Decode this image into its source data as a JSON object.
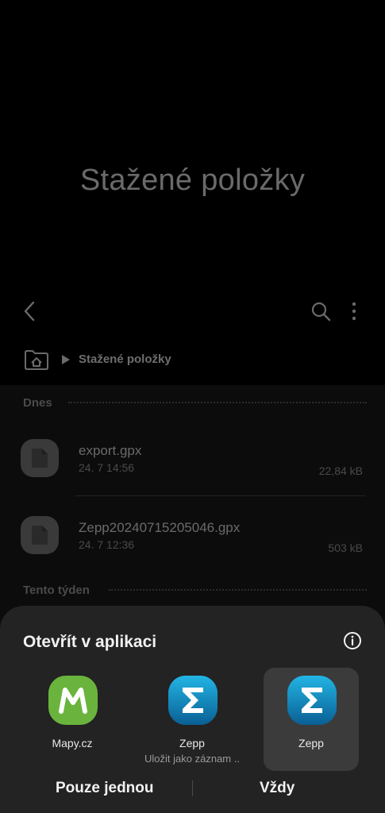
{
  "folder": {
    "title": "Stažené položky",
    "breadcrumb": "Stažené položky"
  },
  "sections": {
    "today": "Dnes",
    "this_week": "Tento týden"
  },
  "files": [
    {
      "name": "export.gpx",
      "date": "24. 7 14:56",
      "size": "22,84 kB"
    },
    {
      "name": "Zepp20240715205046.gpx",
      "date": "24. 7 12:36",
      "size": "503 kB"
    }
  ],
  "sheet": {
    "title": "Otevřít v aplikaci",
    "apps": [
      {
        "label": "Mapy.cz",
        "subtitle": "",
        "color": "#6ab43e"
      },
      {
        "label": "Zepp",
        "subtitle": "Uložit jako záznam ..",
        "color": "#0f7fb8"
      },
      {
        "label": "Zepp",
        "subtitle": "",
        "color": "#0f7fb8",
        "selected": true
      }
    ],
    "just_once": "Pouze jednou",
    "always": "Vždy"
  },
  "icons": {
    "back": "chevron-left-icon",
    "search": "search-icon",
    "more": "more-vertical-icon",
    "home": "home-folder-icon",
    "info": "info-icon"
  }
}
